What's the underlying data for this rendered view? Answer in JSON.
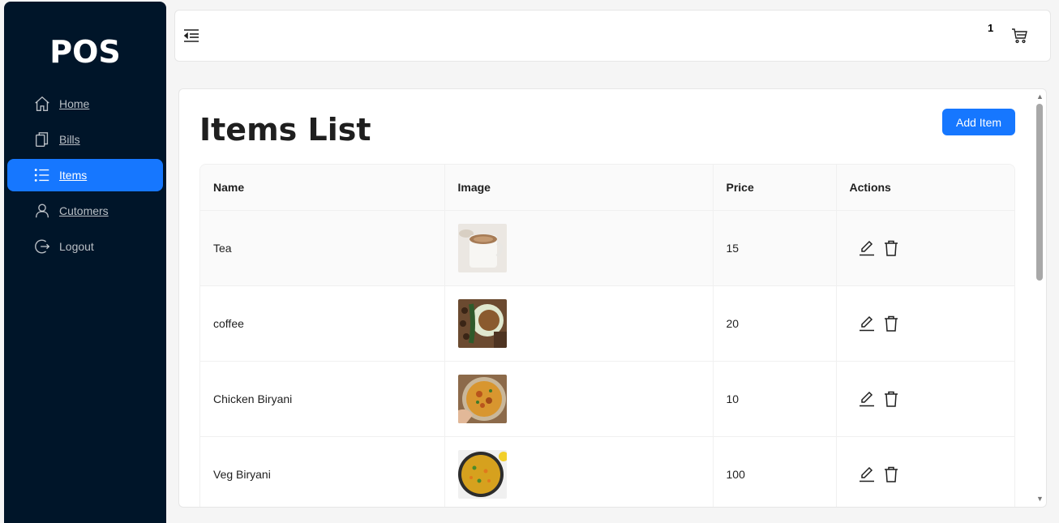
{
  "app": {
    "logo": "POS"
  },
  "sidebar": {
    "items": [
      {
        "label": "Home",
        "icon": "home-icon",
        "active": false
      },
      {
        "label": "Bills",
        "icon": "copy-icon",
        "active": false
      },
      {
        "label": "Items",
        "icon": "list-icon",
        "active": true
      },
      {
        "label": "Cutomers",
        "icon": "user-icon",
        "active": false
      },
      {
        "label": "Logout",
        "icon": "logout-icon",
        "active": false
      }
    ]
  },
  "header": {
    "cart_count": "1",
    "menu_icon": "menu-fold-icon",
    "cart_icon": "cart-icon"
  },
  "main": {
    "title": "Items List",
    "add_button": "Add Item",
    "columns": [
      "Name",
      "Image",
      "Price",
      "Actions"
    ],
    "rows": [
      {
        "name": "Tea",
        "image": "tea-thumbnail",
        "price": "15"
      },
      {
        "name": "coffee",
        "image": "coffee-thumbnail",
        "price": "20"
      },
      {
        "name": "Chicken Biryani",
        "image": "chicken-biryani-thumbnail",
        "price": "10"
      },
      {
        "name": "Veg Biryani",
        "image": "veg-biryani-thumbnail",
        "price": "100"
      }
    ]
  },
  "colors": {
    "sidebar_bg": "#001529",
    "accent": "#1677ff",
    "page_bg": "#f5f5f5"
  }
}
